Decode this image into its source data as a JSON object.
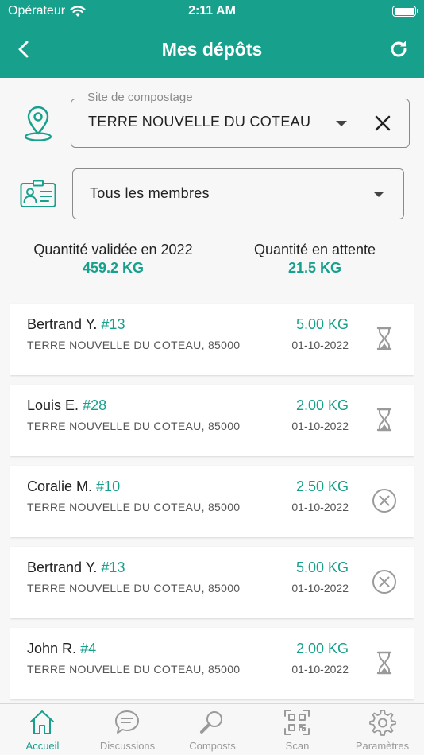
{
  "status_bar": {
    "carrier": "Opérateur",
    "time": "2:11 AM"
  },
  "navbar": {
    "title": "Mes dépôts"
  },
  "filters": {
    "site": {
      "legend": "Site de compostage",
      "value": "TERRE NOUVELLE DU COTEAU"
    },
    "members": {
      "value": "Tous les membres"
    }
  },
  "stats": {
    "validated": {
      "label": "Quantité validée en 2022",
      "value": "459.2 KG"
    },
    "pending": {
      "label": "Quantité en attente",
      "value": "21.5 KG"
    }
  },
  "deposits": [
    {
      "name": "Bertrand Y.",
      "number": "#13",
      "address": "TERRE NOUVELLE DU COTEAU, 85000",
      "quantity": "5.00 KG",
      "date": "01-10-2022",
      "status": "hourglass-icon"
    },
    {
      "name": "Louis E.",
      "number": "#28",
      "address": "TERRE NOUVELLE DU COTEAU, 85000",
      "quantity": "2.00 KG",
      "date": "01-10-2022",
      "status": "hourglass-icon"
    },
    {
      "name": "Coralie M.",
      "number": "#10",
      "address": "TERRE NOUVELLE DU COTEAU, 85000",
      "quantity": "2.50 KG",
      "date": "01-10-2022",
      "status": "rejected-icon"
    },
    {
      "name": "Bertrand Y.",
      "number": "#13",
      "address": "TERRE NOUVELLE DU COTEAU, 85000",
      "quantity": "5.00 KG",
      "date": "01-10-2022",
      "status": "rejected-icon"
    },
    {
      "name": "John R.",
      "number": "#4",
      "address": "TERRE NOUVELLE DU COTEAU, 85000",
      "quantity": "2.00 KG",
      "date": "01-10-2022",
      "status": "hourglass-icon"
    }
  ],
  "tabs": [
    {
      "label": "Accueil",
      "icon": "home-icon",
      "active": true
    },
    {
      "label": "Discussions",
      "icon": "chat-icon",
      "active": false
    },
    {
      "label": "Composts",
      "icon": "search-icon",
      "active": false
    },
    {
      "label": "Scan",
      "icon": "qr-code-icon",
      "active": false
    },
    {
      "label": "Paramètres",
      "icon": "gear-icon",
      "active": false
    }
  ],
  "colors": {
    "accent": "#17a08c",
    "icon_gray": "#9a9a9a"
  }
}
